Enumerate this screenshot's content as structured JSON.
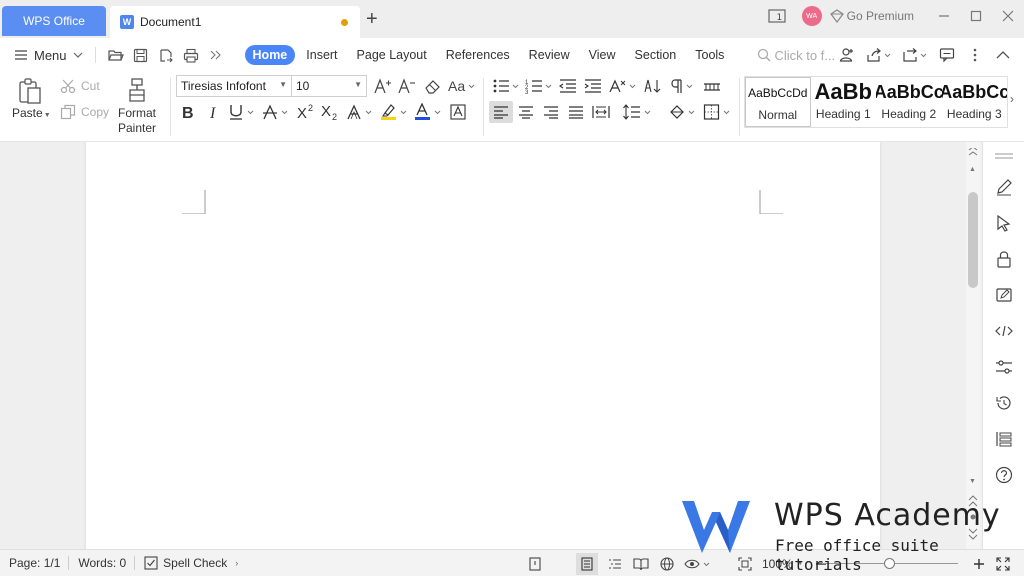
{
  "titlebar": {
    "app_tab": "WPS Office",
    "doc_tab": "Document1",
    "doc_tab_icon": "W",
    "new_tab_symbol": "+",
    "window_count": "1",
    "avatar_initials": "WA",
    "premium_label": "Go Premium"
  },
  "menubar": {
    "menu_label": "Menu",
    "tabs": [
      "Home",
      "Insert",
      "Page Layout",
      "References",
      "Review",
      "View",
      "Section",
      "Tools"
    ],
    "active_tab": "Home",
    "search_placeholder": "Click to f..."
  },
  "ribbon": {
    "paste": "Paste",
    "cut": "Cut",
    "copy": "Copy",
    "format_painter_line1": "Format",
    "format_painter_line2": "Painter",
    "font_name": "Tiresias Infofont",
    "font_size": "10",
    "styles": [
      {
        "sample": "AaBbCcDd",
        "name": "Normal"
      },
      {
        "sample": "AaBb",
        "name": "Heading 1"
      },
      {
        "sample": "AaBbCc",
        "name": "Heading 2"
      },
      {
        "sample": "AaBbCc",
        "name": "Heading 3"
      }
    ]
  },
  "statusbar": {
    "page": "Page: 1/1",
    "words": "Words: 0",
    "spell_check": "Spell Check",
    "zoom": "100%",
    "zoom_level": 0.5
  },
  "watermark": {
    "title": "WPS Academy",
    "subtitle": "Free office suite tutorials"
  },
  "colors": {
    "accent": "#4a86f7",
    "wps_tab": "#5b8ef2",
    "modified_dot": "#e0a200",
    "avatar": "#ec6a8a",
    "highlight_yellow": "#f5d31a",
    "font_color_blue": "#1f4fe0",
    "logo_blue": "#3a78e6"
  }
}
